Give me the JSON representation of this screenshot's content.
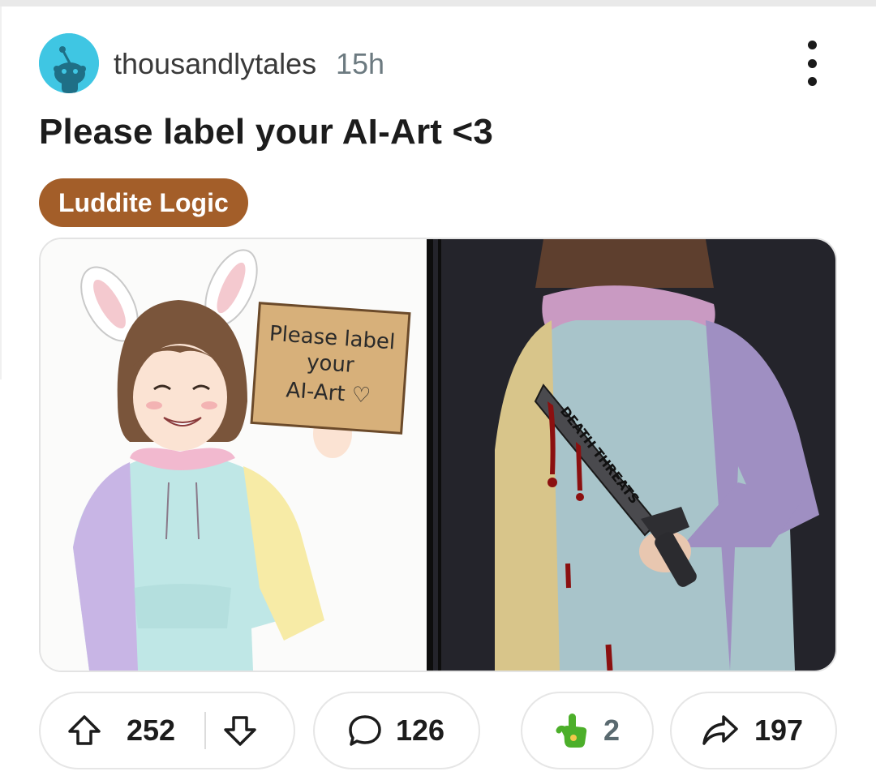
{
  "post": {
    "username": "thousandlytales",
    "time_ago": "15h",
    "title": "Please label your AI-Art <3",
    "flair": "Luddite Logic",
    "flair_color": "#a35e29",
    "avatar_color": "#3fc6e3"
  },
  "media": {
    "left_panel_sign_lines": [
      "Please label",
      "your",
      "AI-Art ♡"
    ],
    "right_panel_knife_text": "DEATH THREATS"
  },
  "actions": {
    "upvotes": "252",
    "comments": "126",
    "awards": "2",
    "shares": "197"
  },
  "icons": {
    "avatar": "reddit-alien-icon",
    "more": "more-vertical-icon",
    "upvote": "arrow-up-icon",
    "downvote": "arrow-down-icon",
    "comment": "speech-bubble-icon",
    "award": "hand-pointer-award-icon",
    "share": "share-arrow-icon"
  }
}
